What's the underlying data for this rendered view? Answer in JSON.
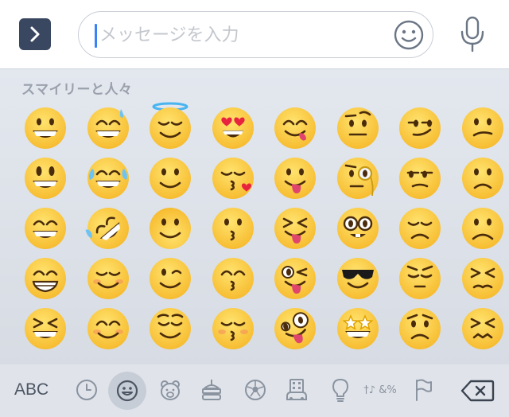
{
  "input": {
    "placeholder": "メッセージを入力",
    "value": ""
  },
  "keyboard": {
    "category_title": "スマイリーと人々",
    "abc_label": "ABC",
    "bottom_icons": [
      "recent-icon",
      "smileys-icon",
      "animals-icon",
      "food-icon",
      "activity-icon",
      "travel-icon",
      "objects-icon",
      "symbols-icon",
      "flags-icon"
    ],
    "symbols_icon_text": "†♪ &%",
    "active_category": "smileys-icon"
  },
  "emojis": [
    "😀",
    "😅",
    "😇",
    "😍",
    "😋",
    "🤨",
    "😏",
    "😕",
    "😃",
    "😂",
    "🙂",
    "😘",
    "😛",
    "🧐",
    "😒",
    "🙁",
    "😄",
    "🤣",
    "🙃",
    "😗",
    "😝",
    "🤓",
    "😞",
    "☹️",
    "😁",
    "☺️",
    "😉",
    "😙",
    "😜",
    "😎",
    "😔",
    "😣",
    "😆",
    "😊",
    "😌",
    "😚",
    "🤪",
    "🤩",
    "😟",
    "😖"
  ],
  "colors": {
    "accent": "#3b82f6",
    "expand_bg": "#3a4760",
    "icon_gray": "#8a93a0",
    "face": "#f6b92b"
  }
}
